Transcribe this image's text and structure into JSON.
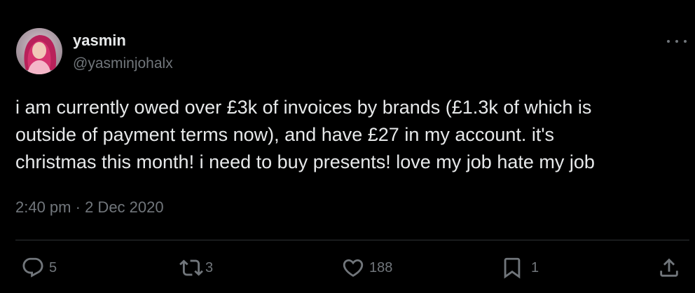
{
  "user": {
    "display_name": "yasmin",
    "handle": "@yasminjohalx"
  },
  "tweet": {
    "lines": [
      "i am currently owed over £3k of invoices by brands (£1.3k of which is",
      "outside of payment terms now), and have £27 in my account. it's",
      "christmas this month! i need to buy presents! love my job hate my job"
    ],
    "time": "2:40 pm",
    "separator": "·",
    "date": "2 Dec 2020"
  },
  "actions": {
    "reply": {
      "icon": "reply-icon",
      "count": "5"
    },
    "retweet": {
      "icon": "retweet-icon",
      "count": "3"
    },
    "like": {
      "icon": "heart-icon",
      "count": "188"
    },
    "bookmark": {
      "icon": "bookmark-icon",
      "count": "1"
    },
    "share": {
      "icon": "share-icon"
    }
  },
  "colors": {
    "background": "#000000",
    "text": "#e7e9ea",
    "muted": "#71767b",
    "divider": "#2f3336"
  }
}
